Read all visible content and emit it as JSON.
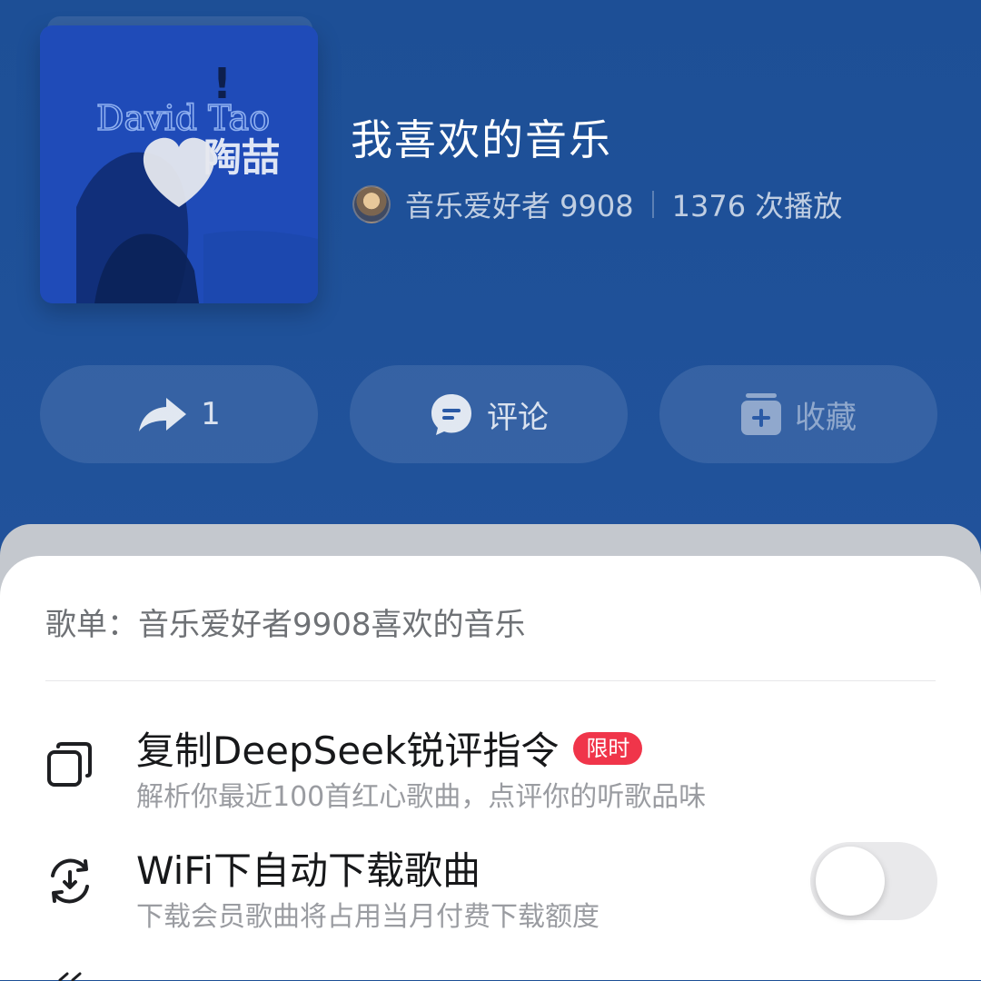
{
  "header": {
    "playlist_title": "我喜欢的音乐",
    "creator_name": "音乐爱好者 9908",
    "play_count": "1376 次播放",
    "cover": {
      "text": "David Tao",
      "subtitle": "陶喆",
      "exclaim": "!"
    }
  },
  "actions": {
    "share_count": "1",
    "comment_label": "评论",
    "collect_label": "收藏"
  },
  "sheet": {
    "playlist_line": "歌单：音乐爱好者9908喜欢的音乐",
    "items": [
      {
        "title": "复制DeepSeek锐评指令",
        "badge": "限时",
        "subtitle": "解析你最近100首红心歌曲，点评你的听歌品味"
      },
      {
        "title": "WiFi下自动下载歌曲",
        "subtitle": "下载会员歌曲将占用当月付费下载额度",
        "toggle_on": false
      }
    ]
  },
  "colors": {
    "header_bg": "#1d4f96",
    "badge_red": "#f0354a",
    "sheet_bg": "#ffffff"
  }
}
